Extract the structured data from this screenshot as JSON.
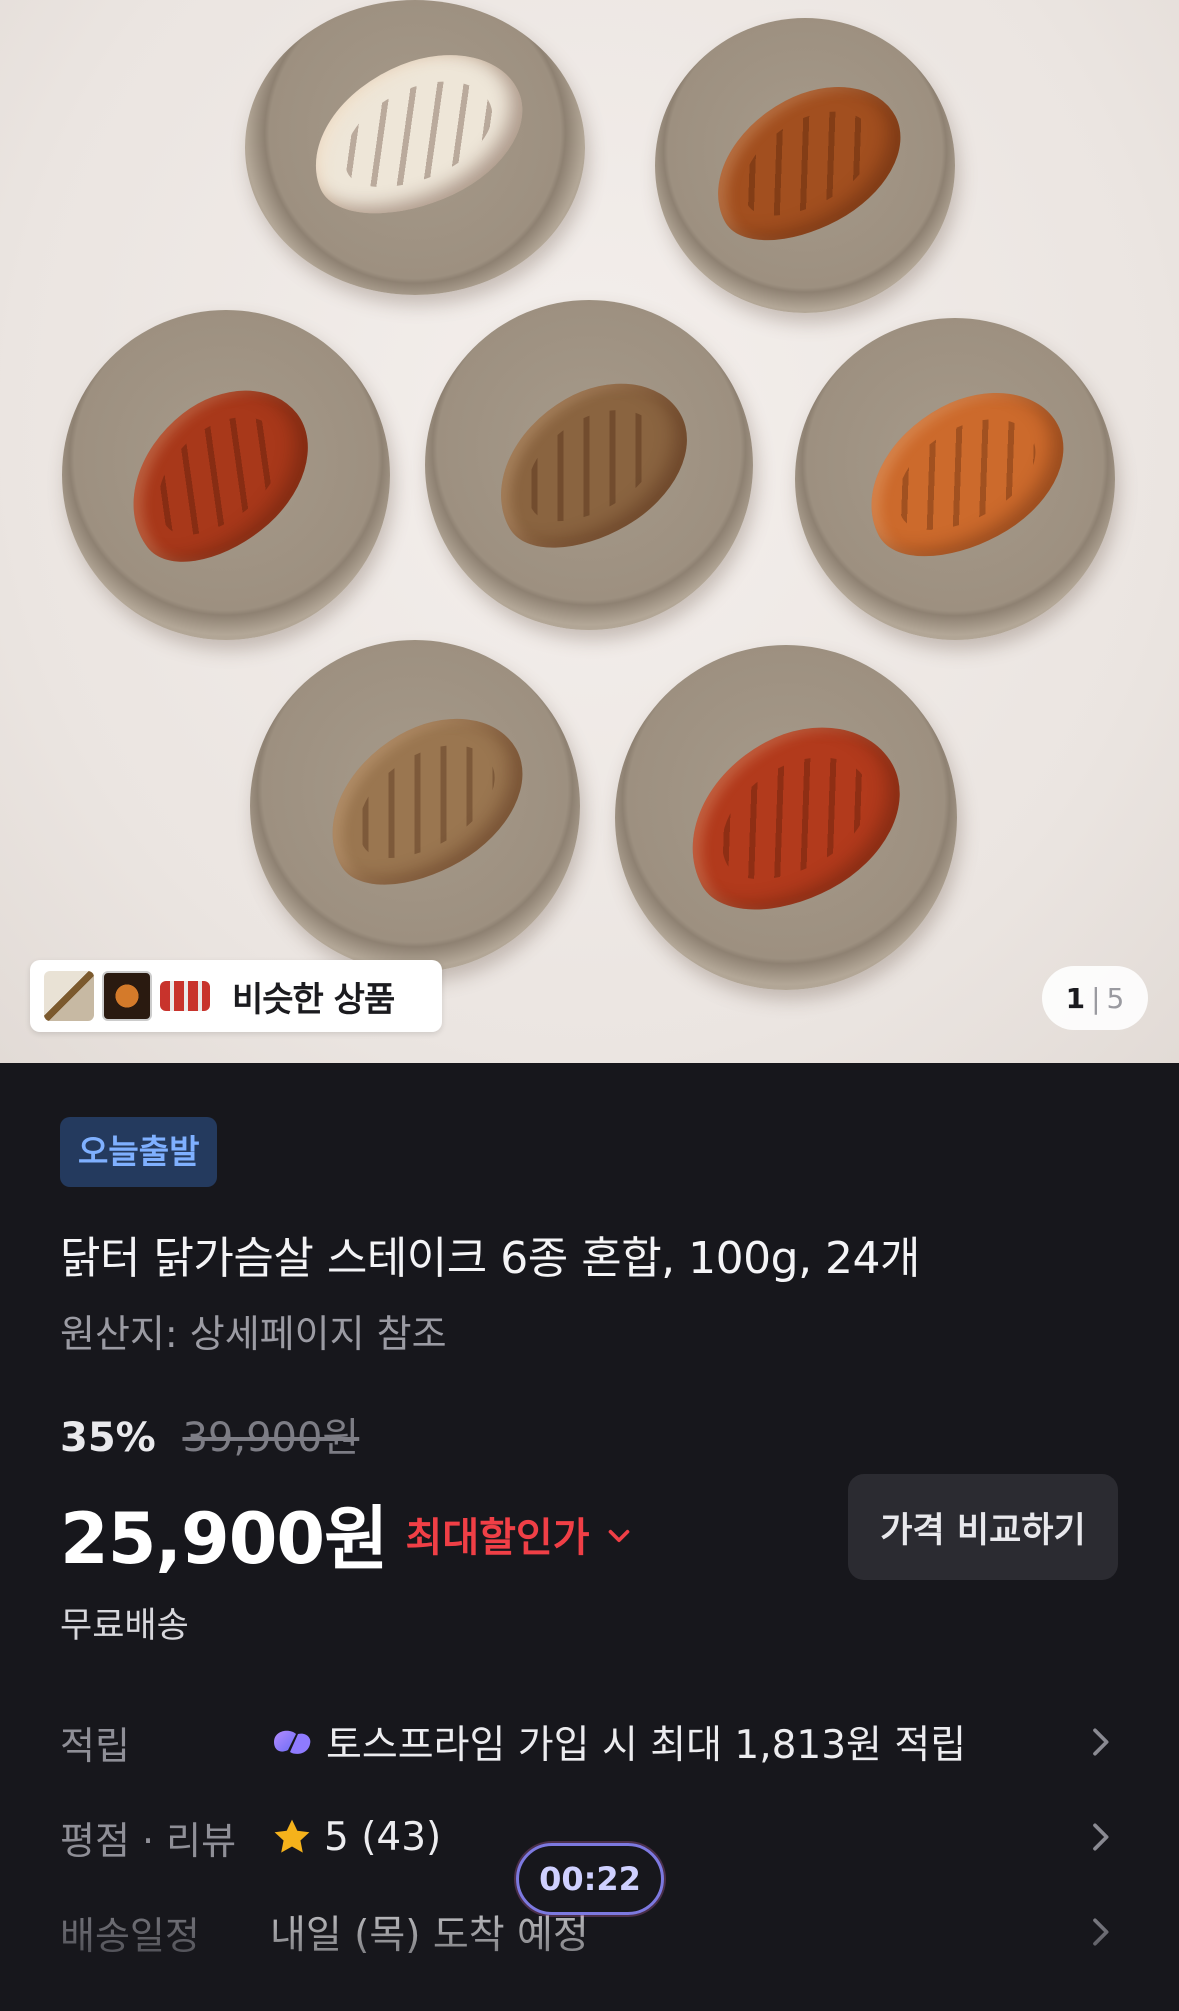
{
  "gallery": {
    "similar_label": "비슷한 상품",
    "pager_current": "1",
    "pager_separator": "|",
    "pager_total": "5"
  },
  "product": {
    "badge": "오늘출발",
    "title": "닭터 닭가슴살 스테이크 6종 혼합, 100g, 24개",
    "origin": "원산지: 상세페이지 참조",
    "discount_rate": "35%",
    "original_price": "39,900원",
    "price": "25,900원",
    "max_discount_label": "최대할인가",
    "compare_button": "가격 비교하기",
    "shipping": "무료배송"
  },
  "info_rows": {
    "reward": {
      "label": "적립",
      "value": "토스프라임 가입 시 최대 1,813원 적립"
    },
    "rating": {
      "label": "평점 · 리뷰",
      "value": "5 (43)"
    },
    "delivery": {
      "label": "배송일정",
      "value": "내일 (목) 도착 예정"
    }
  },
  "timer": "00:22",
  "colors": {
    "background": "#17171c",
    "badge_bg": "#243a5e",
    "badge_text": "#7fb0ff",
    "discount_red": "#f03f46",
    "star": "#f5b21b"
  }
}
